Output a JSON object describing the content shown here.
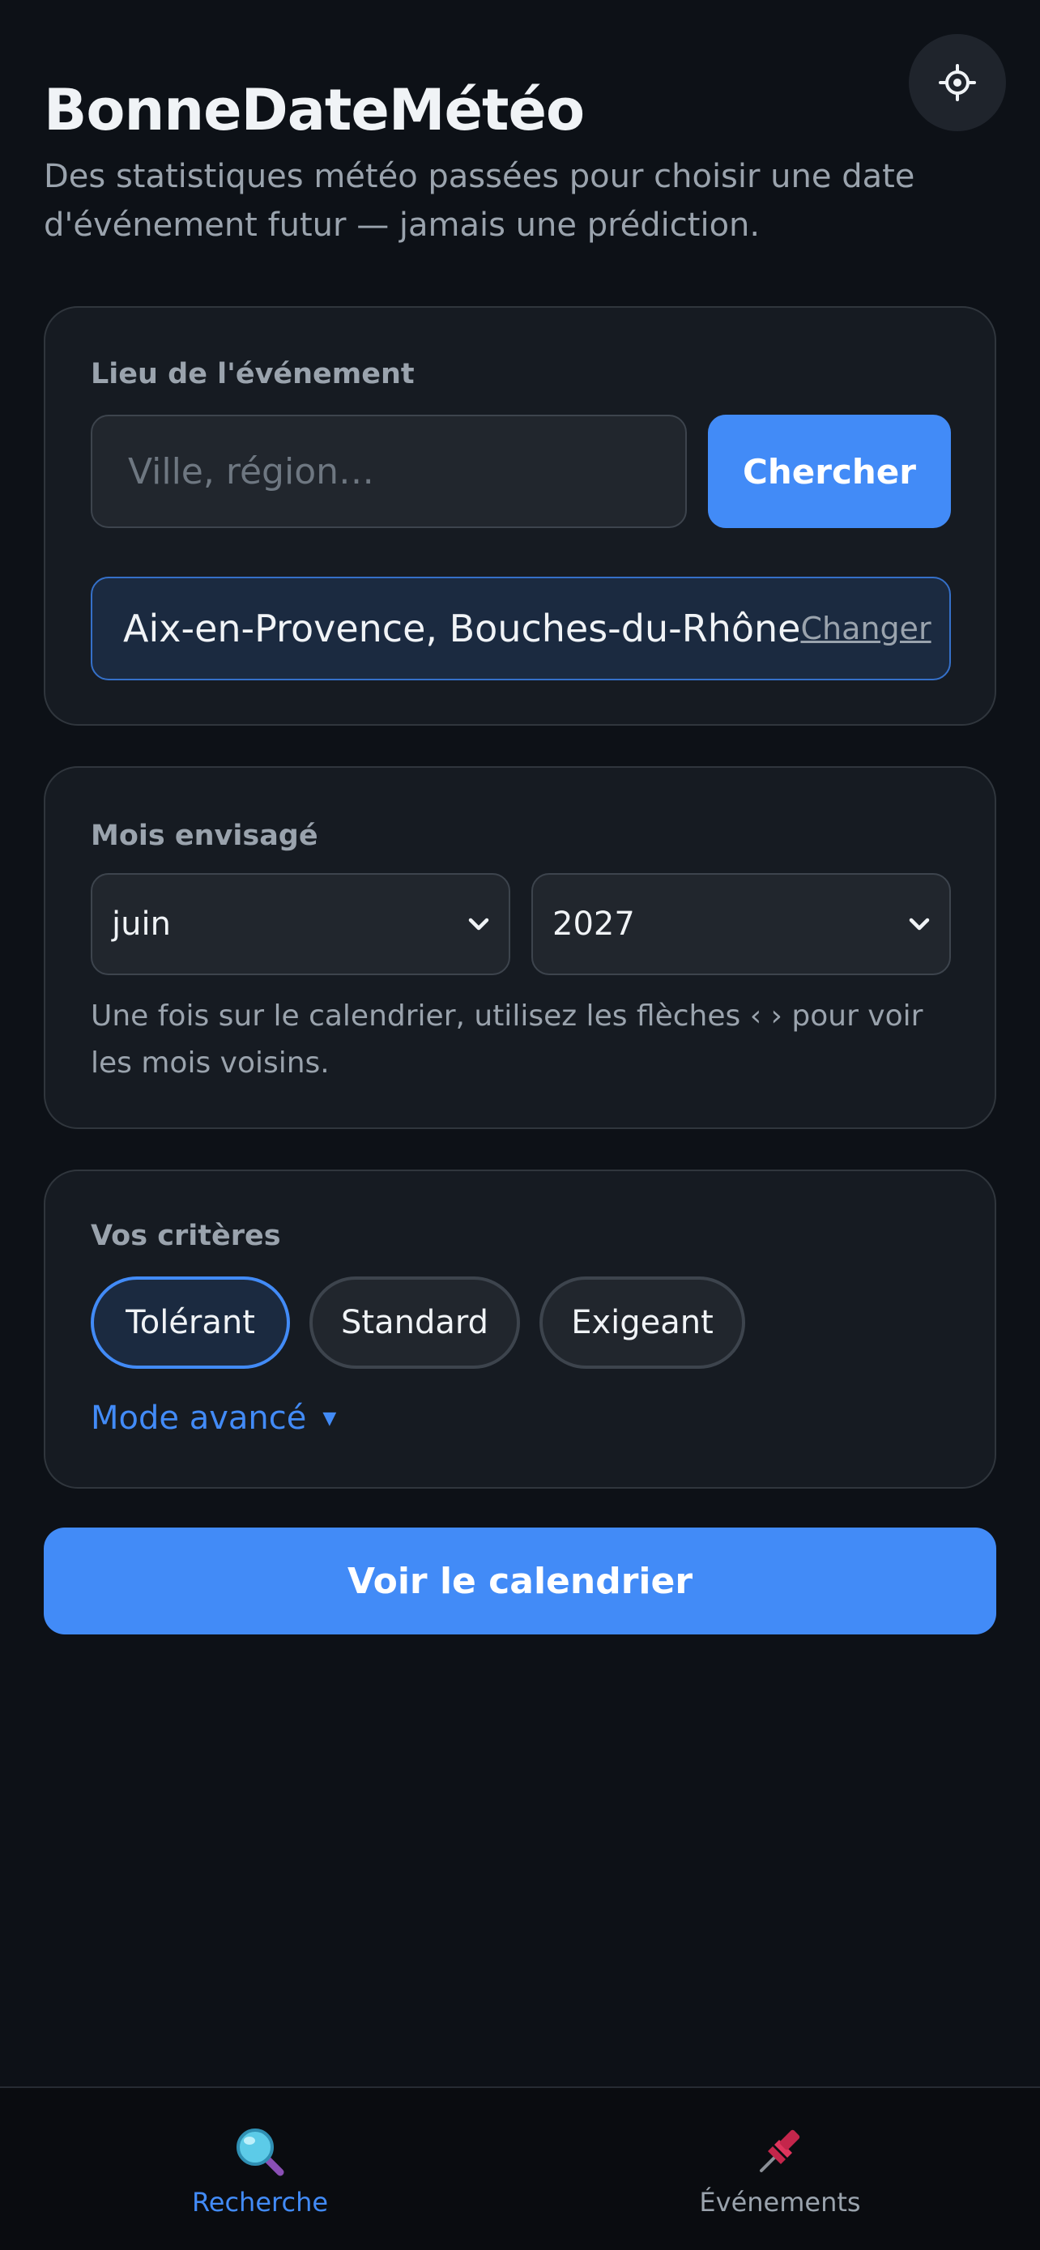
{
  "app": {
    "title": "BonneDateMétéo",
    "subtitle": "Des statistiques météo passées pour choisir une date d'événement futur — jamais une prédiction."
  },
  "settings": {
    "icon": "gear-icon"
  },
  "location_card": {
    "label": "Lieu de l'événement",
    "search_placeholder": "Ville, région…",
    "search_value": "",
    "search_button": "Chercher",
    "selected_location": "Aix-en-Provence, Bouches-du-Rhône",
    "change_link": "Changer"
  },
  "month_card": {
    "label": "Mois envisagé",
    "month_value": "juin",
    "year_value": "2027",
    "hint": "Une fois sur le calendrier, utilisez les flèches ‹ › pour voir les mois voisins."
  },
  "criteria_card": {
    "label": "Vos critères",
    "options": [
      {
        "label": "Tolérant",
        "selected": true
      },
      {
        "label": "Standard",
        "selected": false
      },
      {
        "label": "Exigeant",
        "selected": false
      }
    ],
    "advanced_mode": "Mode avancé",
    "advanced_icon": "triangle-down-icon"
  },
  "cta": {
    "label": "Voir le calendrier"
  },
  "bottom_nav": {
    "items": [
      {
        "label": "Recherche",
        "icon": "magnifier-icon",
        "active": true
      },
      {
        "label": "Événements",
        "icon": "pushpin-icon",
        "active": false
      }
    ]
  },
  "colors": {
    "background": "#0d1117",
    "card": "#161b22",
    "accent": "#428bf7",
    "muted_text": "#9aa3ad"
  }
}
